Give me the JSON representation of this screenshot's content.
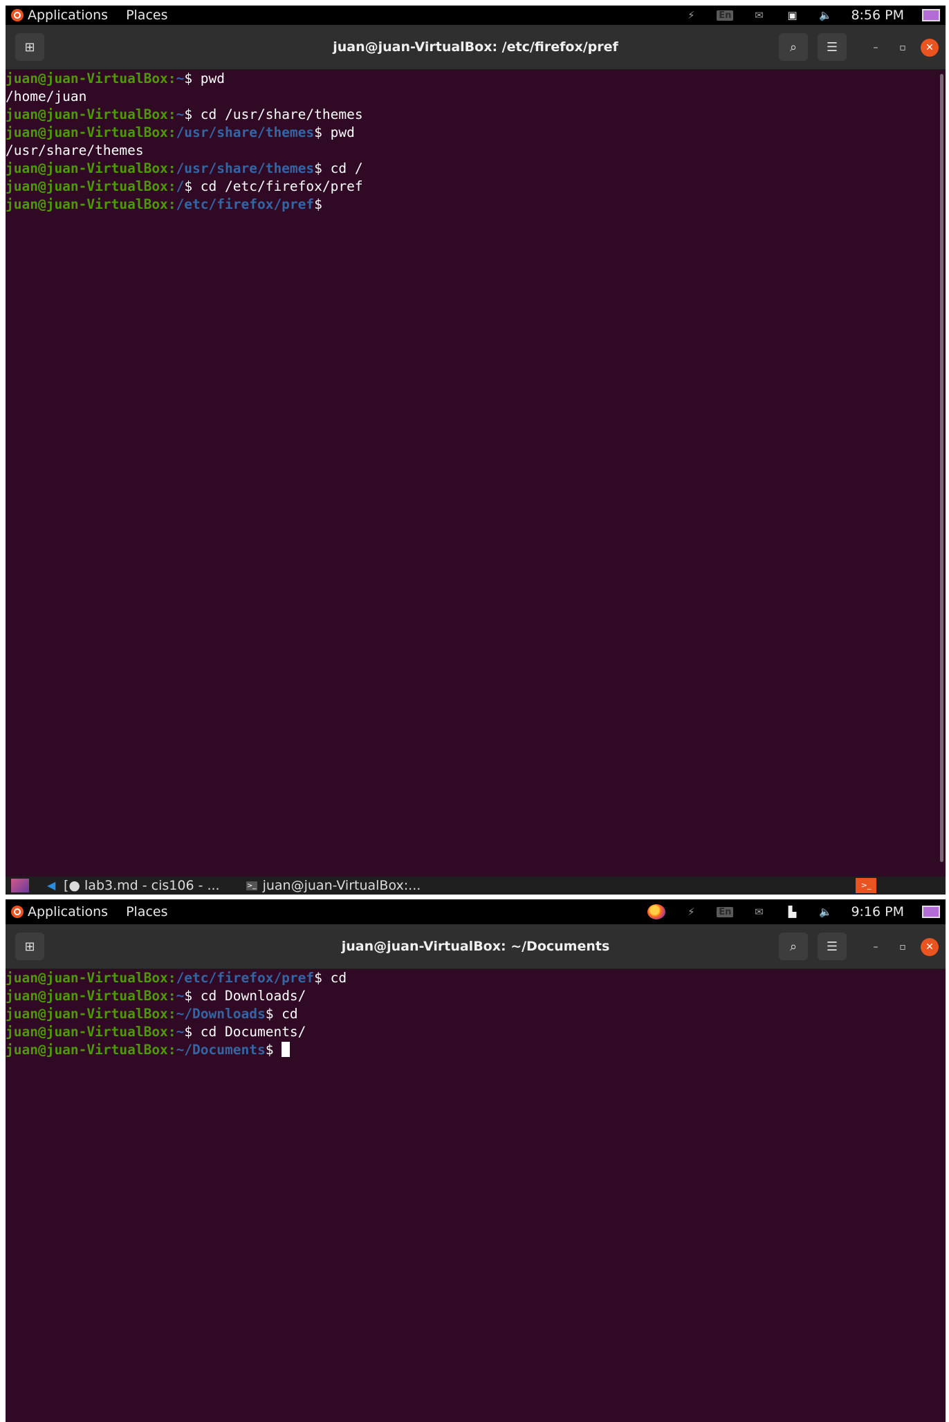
{
  "screens": [
    {
      "panel": {
        "applications_label": "Applications",
        "places_label": "Places",
        "keyboard_layout": "En",
        "clock": "8:56 PM"
      },
      "window": {
        "title": "juan@juan-VirtualBox: /etc/firefox/pref"
      },
      "terminal": {
        "lines": [
          {
            "user": "juan@juan-VirtualBox",
            "sep": ":",
            "path": "~",
            "rest": "$ pwd"
          },
          {
            "text": "/home/juan"
          },
          {
            "user": "juan@juan-VirtualBox",
            "sep": ":",
            "path": "~",
            "rest": "$ cd /usr/share/themes"
          },
          {
            "user": "juan@juan-VirtualBox",
            "sep": ":",
            "path": "/usr/share/themes",
            "rest": "$ pwd"
          },
          {
            "text": "/usr/share/themes"
          },
          {
            "user": "juan@juan-VirtualBox",
            "sep": ":",
            "path": "/usr/share/themes",
            "rest": "$ cd /"
          },
          {
            "user": "juan@juan-VirtualBox",
            "sep": ":",
            "path": "/",
            "rest": "$ cd /etc/firefox/pref"
          },
          {
            "user": "juan@juan-VirtualBox",
            "sep": ":",
            "path": "/etc/firefox/pref",
            "rest": "$"
          }
        ]
      },
      "taskbar": {
        "tasks": [
          {
            "label": "[● lab3.md - cis106 - ...",
            "icon": "vscode-icon"
          },
          {
            "label": "juan@juan-VirtualBox:...",
            "icon": "terminal-icon"
          }
        ]
      }
    },
    {
      "panel": {
        "applications_label": "Applications",
        "places_label": "Places",
        "keyboard_layout": "En",
        "clock": "9:16 PM"
      },
      "window": {
        "title": "juan@juan-VirtualBox: ~/Documents"
      },
      "terminal": {
        "lines": [
          {
            "user": "juan@juan-VirtualBox",
            "sep": ":",
            "path": "/etc/firefox/pref",
            "rest": "$ cd"
          },
          {
            "user": "juan@juan-VirtualBox",
            "sep": ":",
            "path": "~",
            "rest": "$ cd Downloads/"
          },
          {
            "user": "juan@juan-VirtualBox",
            "sep": ":",
            "path": "~/Downloads",
            "rest": "$ cd"
          },
          {
            "user": "juan@juan-VirtualBox",
            "sep": ":",
            "path": "~",
            "rest": "$ cd Documents/"
          },
          {
            "user": "juan@juan-VirtualBox",
            "sep": ":",
            "path": "~/Documents",
            "rest": "$ "
          }
        ]
      }
    }
  ],
  "colors": {
    "terminal_bg": "#300a24",
    "prompt_user": "#4e9a06",
    "prompt_path": "#3465a4",
    "accent": "#e95420"
  }
}
